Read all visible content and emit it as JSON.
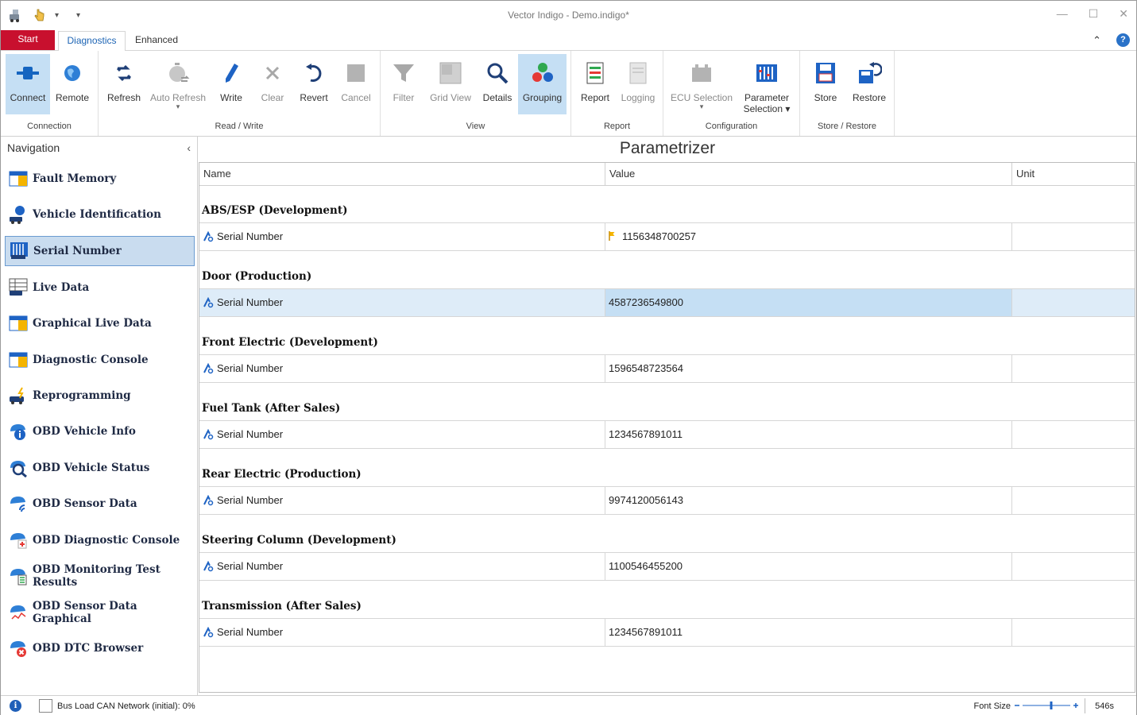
{
  "window": {
    "title": "Vector Indigo  - Demo.indigo*",
    "minimize": "—",
    "maximize": "☐",
    "close": "✕",
    "qat_dropdown": "▾"
  },
  "tabs": {
    "start": "Start",
    "diagnostics": "Diagnostics",
    "enhanced": "Enhanced",
    "collapse": "⌃",
    "help": "?"
  },
  "ribbon": {
    "groups": {
      "connection": "Connection",
      "read_write": "Read / Write",
      "view": "View",
      "report": "Report",
      "configuration": "Configuration",
      "store_restore": "Store / Restore"
    },
    "buttons": {
      "connect": "Connect",
      "remote": "Remote",
      "refresh": "Refresh",
      "auto_refresh": "Auto Refresh",
      "write": "Write",
      "clear": "Clear",
      "revert": "Revert",
      "cancel": "Cancel",
      "filter": "Filter",
      "grid_view": "Grid View",
      "details": "Details",
      "grouping": "Grouping",
      "report": "Report",
      "logging": "Logging",
      "ecu_selection": "ECU Selection",
      "parameter_selection_1": "Parameter",
      "parameter_selection_2": "Selection ▾",
      "store": "Store",
      "restore": "Restore",
      "dropdown_mark": "▾"
    }
  },
  "navigation": {
    "title": "Navigation",
    "collapse": "‹",
    "items": [
      {
        "label": "Fault Memory"
      },
      {
        "label": "Vehicle Identification"
      },
      {
        "label": "Serial Number"
      },
      {
        "label": "Live Data"
      },
      {
        "label": "Graphical Live Data"
      },
      {
        "label": "Diagnostic Console"
      },
      {
        "label": "Reprogramming"
      },
      {
        "label": "OBD Vehicle Info"
      },
      {
        "label": "OBD Vehicle Status"
      },
      {
        "label": "OBD Sensor Data"
      },
      {
        "label": "OBD Diagnostic Console"
      },
      {
        "label": "OBD Monitoring Test Results"
      },
      {
        "label": "OBD Sensor Data Graphical"
      },
      {
        "label": "OBD DTC Browser"
      }
    ]
  },
  "main": {
    "title": "Parametrizer",
    "columns": {
      "name": "Name",
      "value": "Value",
      "unit": "Unit"
    },
    "groups": [
      {
        "title": "ABS/ESP (Development)",
        "name": "Serial Number",
        "value": "1156348700257",
        "unit": ""
      },
      {
        "title": "Door (Production)",
        "name": "Serial Number",
        "value": "4587236549800",
        "unit": ""
      },
      {
        "title": "Front Electric (Development)",
        "name": "Serial Number",
        "value": "1596548723564",
        "unit": ""
      },
      {
        "title": "Fuel Tank (After Sales)",
        "name": "Serial Number",
        "value": "1234567891011",
        "unit": ""
      },
      {
        "title": "Rear Electric (Production)",
        "name": "Serial Number",
        "value": "9974120056143",
        "unit": ""
      },
      {
        "title": "Steering Column (Development)",
        "name": "Serial Number",
        "value": "1100546455200",
        "unit": ""
      },
      {
        "title": "Transmission (After Sales)",
        "name": "Serial Number",
        "value": "1234567891011",
        "unit": ""
      }
    ]
  },
  "status": {
    "info": "i",
    "bus_load": "Bus Load CAN Network (initial): 0%",
    "font_size": "Font Size",
    "font_size_level": 0.6,
    "timer": "546s"
  }
}
